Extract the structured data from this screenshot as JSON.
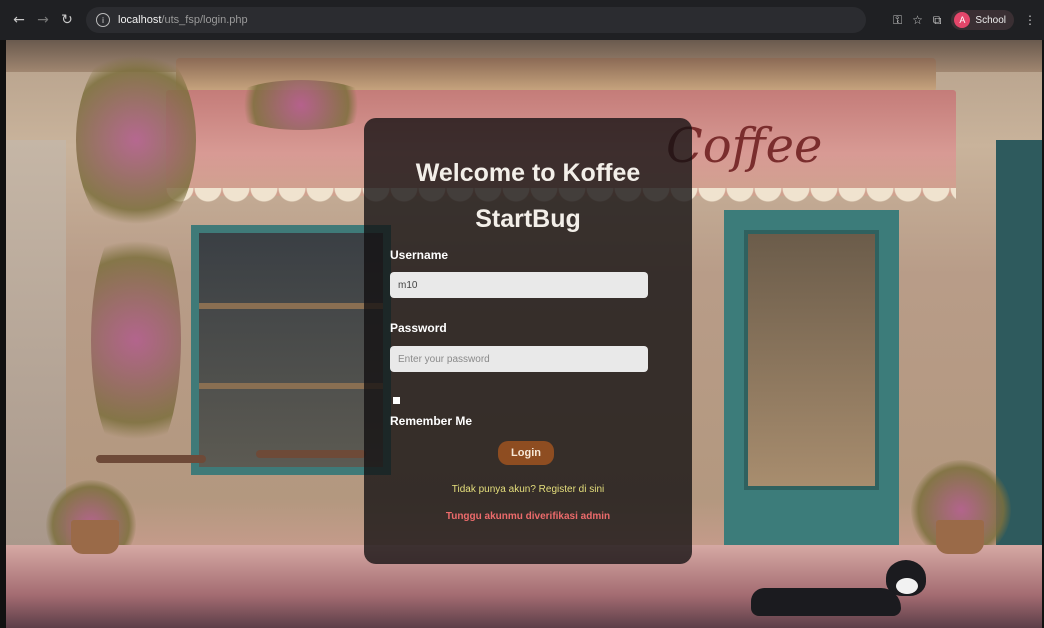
{
  "browser": {
    "back_icon": "arrow-left-icon",
    "forward_icon": "arrow-right-icon",
    "reload_icon": "reload-icon",
    "url_host": "localhost",
    "url_path": "/uts_fsp/login.php",
    "profile_initial": "A",
    "profile_label": "School",
    "colors": {
      "chrome_bg": "#1f2023",
      "profile_accent": "#e4466a"
    }
  },
  "scene": {
    "sign_text": "Coffee"
  },
  "login": {
    "title_line1": "Welcome to Koffee",
    "title_line2": "StartBug",
    "username_label": "Username",
    "username_value": "m10",
    "password_label": "Password",
    "password_placeholder": "Enter your password",
    "remember_label": "Remember Me",
    "login_button": "Login",
    "register_link": "Tidak punya akun? Register di sini",
    "verify_message": "Tunggu akunmu diverifikasi admin",
    "colors": {
      "button": "#8e4d21",
      "register_link": "#e5df7c",
      "verify_message": "#ec6b6b"
    }
  }
}
